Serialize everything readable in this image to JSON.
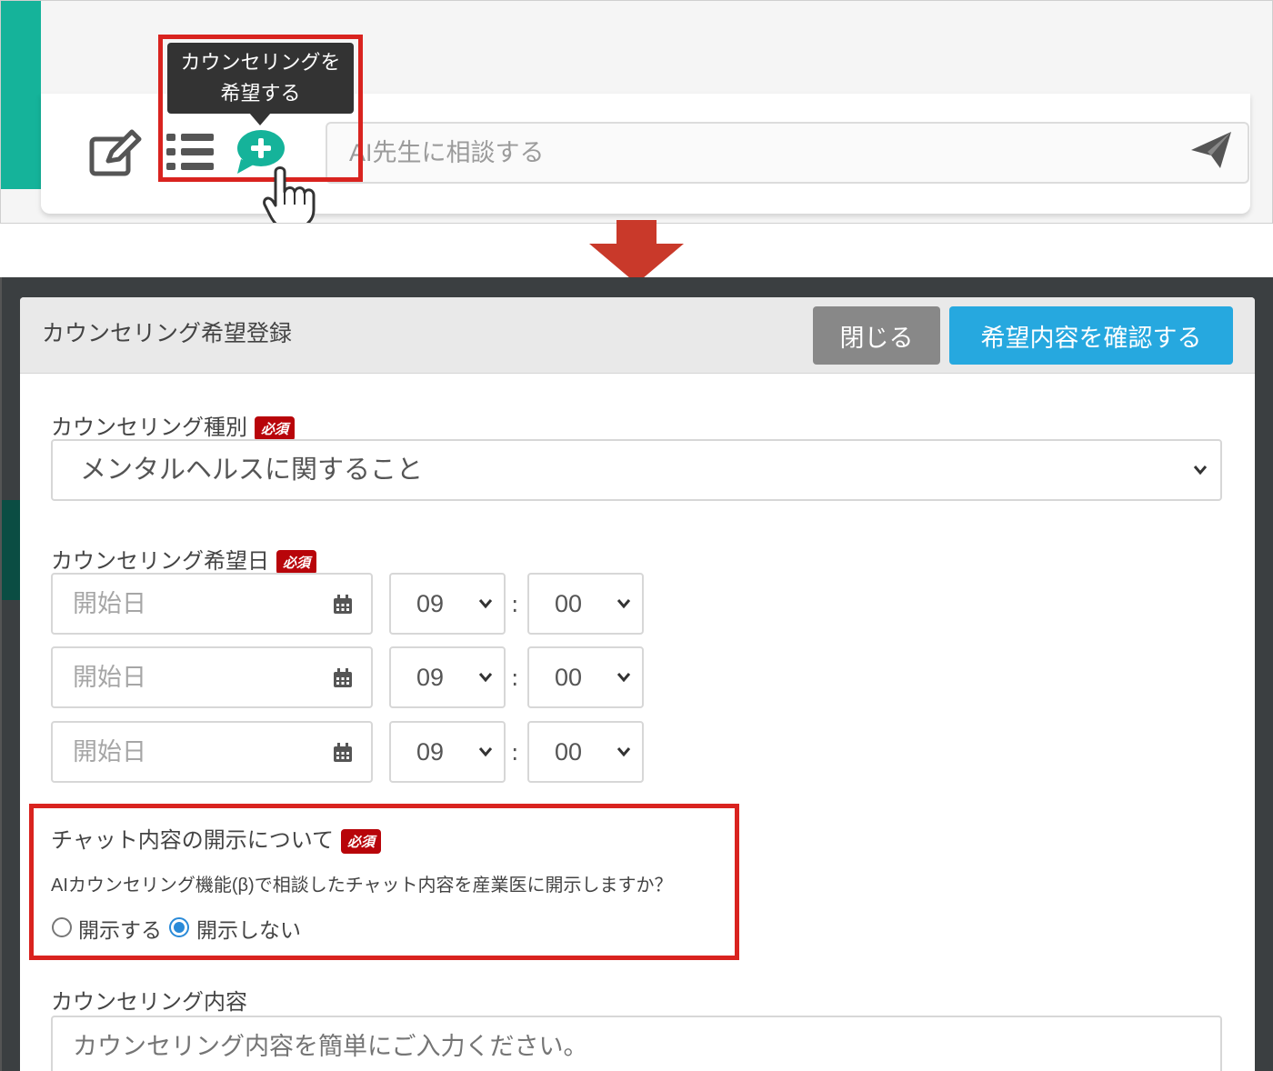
{
  "chat_bar": {
    "tooltip_line1": "カウンセリングを",
    "tooltip_line2": "希望する",
    "input_placeholder": "AI先生に相談する",
    "accent_color": "#15b39a",
    "icons": [
      "edit-icon",
      "list-icon",
      "counseling-request-icon",
      "send-icon"
    ]
  },
  "modal": {
    "title": "カウンセリング希望登録",
    "close_label": "閉じる",
    "confirm_label": "希望内容を確認する",
    "required_badge": "必須",
    "type_field": {
      "label": "カウンセリング種別",
      "value": "メンタルヘルスに関すること"
    },
    "date_field": {
      "label": "カウンセリング希望日",
      "rows": [
        {
          "date_placeholder": "開始日",
          "hour": "09",
          "minute": "00"
        },
        {
          "date_placeholder": "開始日",
          "hour": "09",
          "minute": "00"
        },
        {
          "date_placeholder": "開始日",
          "hour": "09",
          "minute": "00"
        }
      ],
      "colon": ":"
    },
    "disclose_field": {
      "label": "チャット内容の開示について",
      "question": "AIカウンセリング機能(β)で相談したチャット内容を産業医に開示しますか？",
      "option_yes": "開示する",
      "option_no": "開示しない",
      "selected": "開示しない"
    },
    "content_field": {
      "label": "カウンセリング内容",
      "placeholder": "カウンセリング内容を簡単にご入力ください。"
    }
  },
  "colors": {
    "highlight_red": "#d9231f",
    "confirm_blue": "#26a8df",
    "close_gray": "#888888",
    "required_red": "#b8050a"
  }
}
